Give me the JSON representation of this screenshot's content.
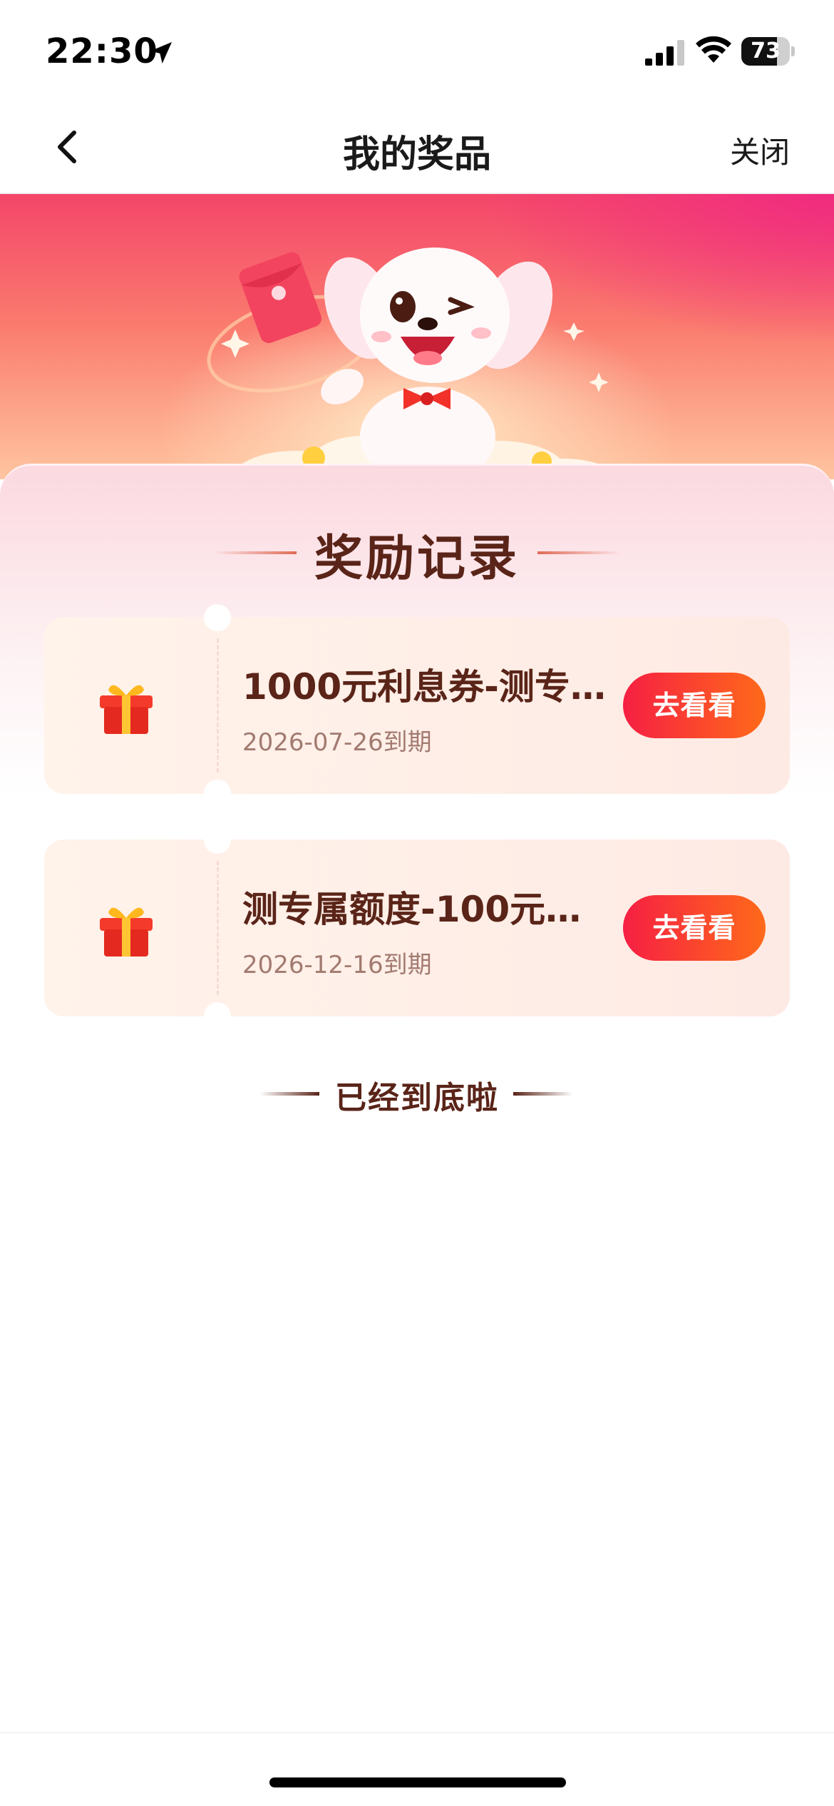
{
  "status_bar": {
    "time": "22:30",
    "battery_level": "73",
    "battery_fraction": 0.73,
    "icons": [
      "location-arrow-icon",
      "signal-icon",
      "wifi-icon",
      "battery-icon"
    ]
  },
  "nav": {
    "back_icon": "chevron-left-icon",
    "title": "我的奖品",
    "close_label": "关闭"
  },
  "banner": {
    "image": "mascot-dog-red-envelope"
  },
  "section": {
    "title": "奖励记录"
  },
  "prizes": [
    {
      "icon": "gift-box-icon",
      "title": "1000元利息券-测专…",
      "expiry": "2026-07-26到期",
      "button_label": "去看看"
    },
    {
      "icon": "gift-box-icon",
      "title": "测专属额度-100元…",
      "expiry": "2026-12-16到期",
      "button_label": "去看看"
    }
  ],
  "end_text": "已经到底啦",
  "colors": {
    "accent_start": "#f61f43",
    "accent_end": "#ff6a1a",
    "title_brown": "#5a2418",
    "date_grey": "#a27a70"
  }
}
